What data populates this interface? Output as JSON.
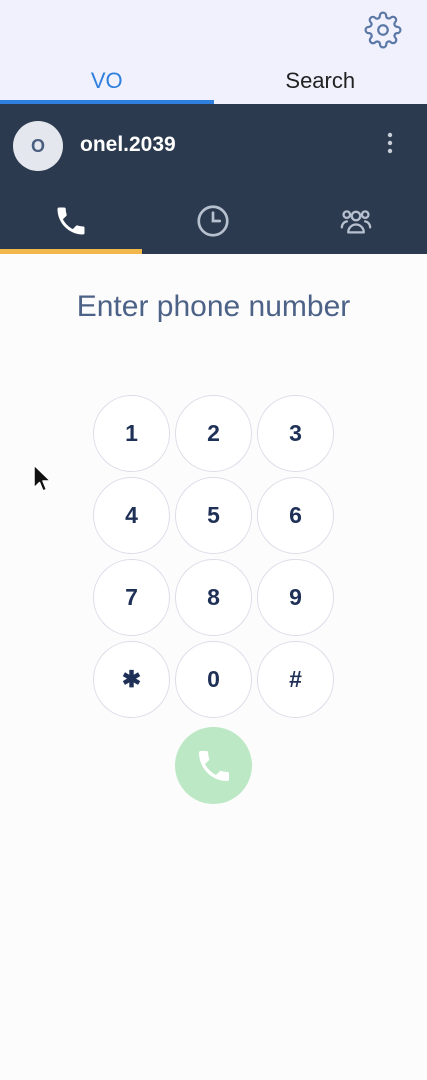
{
  "top_tabs": [
    {
      "label": "VO",
      "active": true
    },
    {
      "label": "Search",
      "active": false
    }
  ],
  "user": {
    "initial": "O",
    "name": "onel.2039"
  },
  "sub_tabs": [
    {
      "icon": "phone-icon",
      "active": true
    },
    {
      "icon": "clock-icon",
      "active": false
    },
    {
      "icon": "contacts-icon",
      "active": false
    }
  ],
  "dialer": {
    "prompt": "Enter phone number",
    "keys": [
      "1",
      "2",
      "3",
      "4",
      "5",
      "6",
      "7",
      "8",
      "9",
      "✱",
      "0",
      "#"
    ]
  },
  "colors": {
    "accent": "#2f7fde",
    "header": "#2b3a4e",
    "active_tab": "#f2b84b",
    "call_button": "#bde8c5"
  }
}
